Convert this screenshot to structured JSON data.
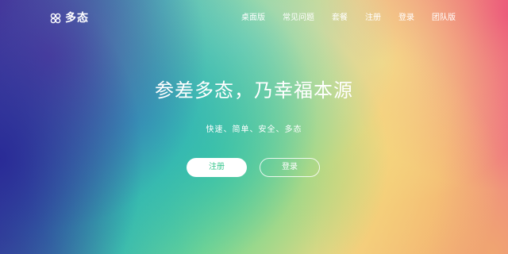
{
  "brand": {
    "logo_text": "多态",
    "logo_icon": "double-infinity-logo-icon"
  },
  "nav": {
    "items": [
      {
        "label": "桌面版"
      },
      {
        "label": "常见问题"
      },
      {
        "label": "套餐"
      },
      {
        "label": "注册"
      },
      {
        "label": "登录"
      },
      {
        "label": "团队版"
      }
    ]
  },
  "hero": {
    "headline": "参差多态，乃幸福本源",
    "subline": "快速、简单、安全、多态",
    "register_label": "注册",
    "login_label": "登录"
  },
  "colors": {
    "register_text": "#38c68e",
    "text": "#ffffff"
  }
}
